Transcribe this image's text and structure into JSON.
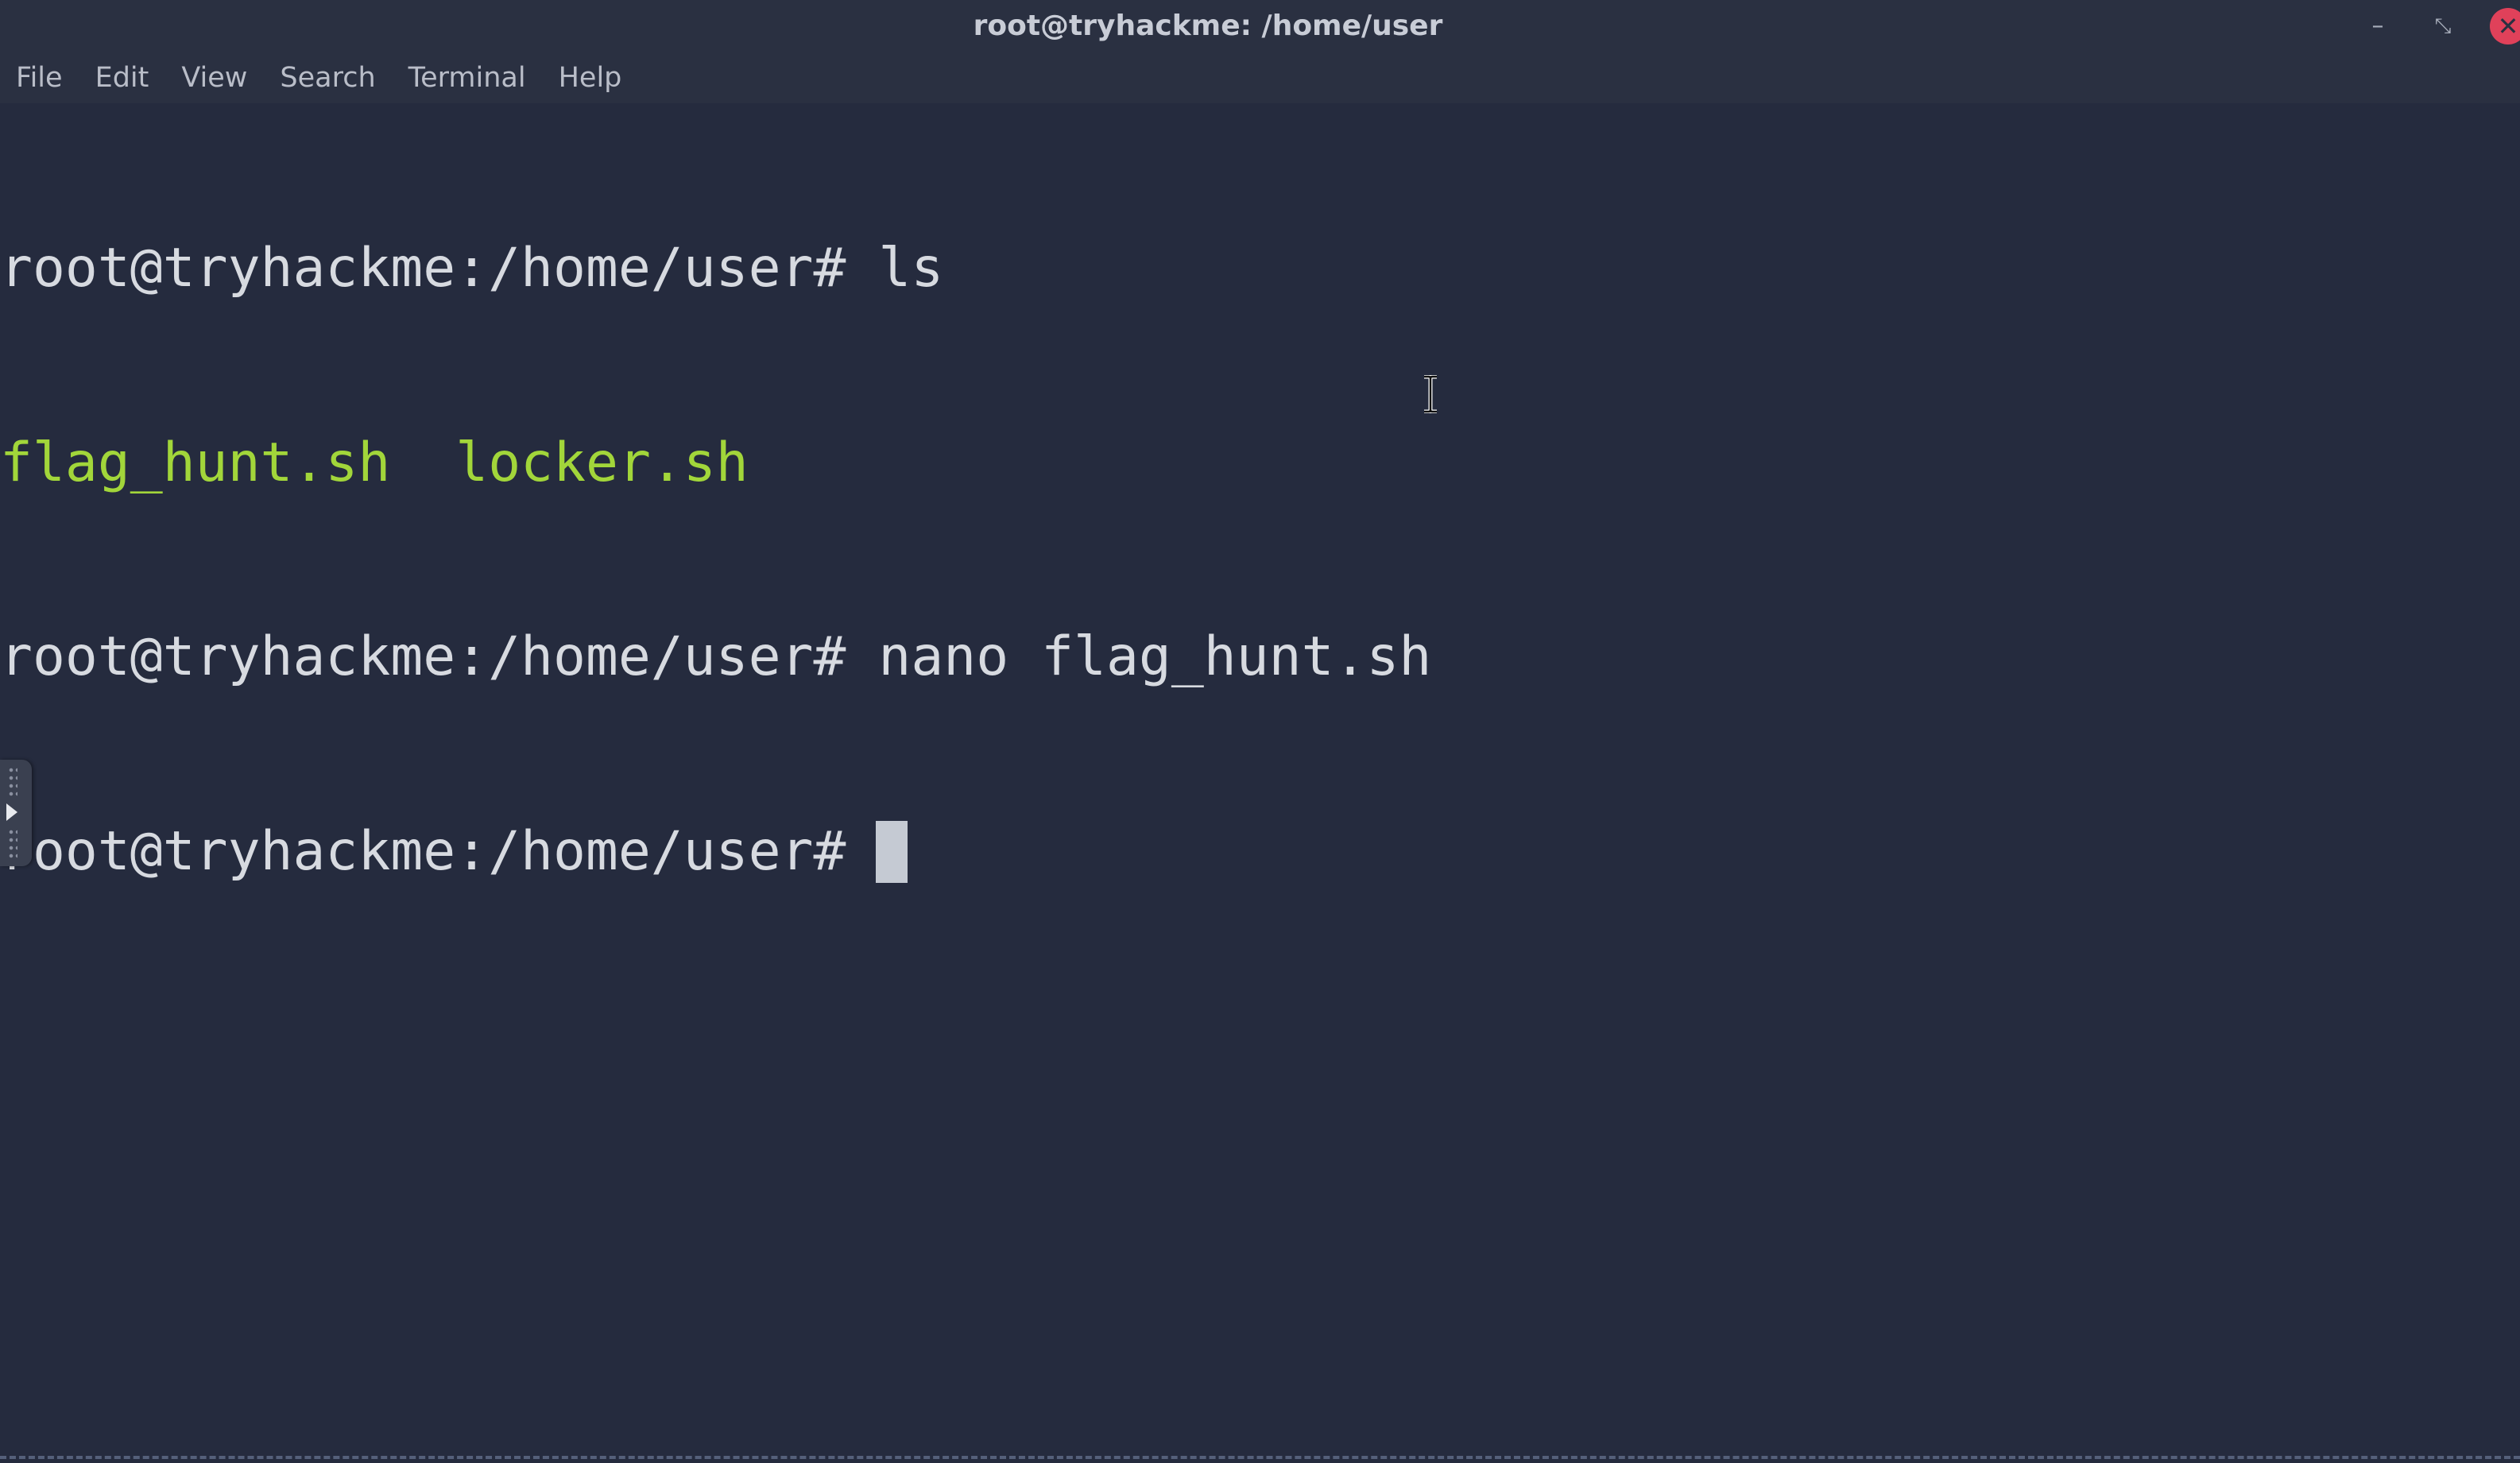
{
  "window": {
    "title": "root@tryhackme: /home/user",
    "controls": {
      "minimize": "–",
      "maximize": "⤡",
      "close": "✕"
    }
  },
  "menu": {
    "file": "File",
    "edit": "Edit",
    "view": "View",
    "search": "Search",
    "terminal": "Terminal",
    "help": "Help"
  },
  "terminal": {
    "prompt": "root@tryhackme:/home/user#",
    "lines": [
      {
        "prompt": "root@tryhackme:/home/user#",
        "command": " ls"
      },
      {
        "outputs": [
          "flag_hunt.sh",
          "locker.sh"
        ]
      },
      {
        "prompt": "root@tryhackme:/home/user#",
        "command": " nano flag_hunt.sh"
      },
      {
        "prompt": "root@tryhackme:/home/user#",
        "command": ""
      }
    ]
  },
  "colors": {
    "background": "#252b3e",
    "executable": "#a2d63a",
    "text": "#d7dae0",
    "close_button": "#e0415a"
  },
  "icons": {
    "mouse_cursor": "text-ibeam-cursor-icon",
    "side_panel": "expand-panel-arrow-icon"
  }
}
